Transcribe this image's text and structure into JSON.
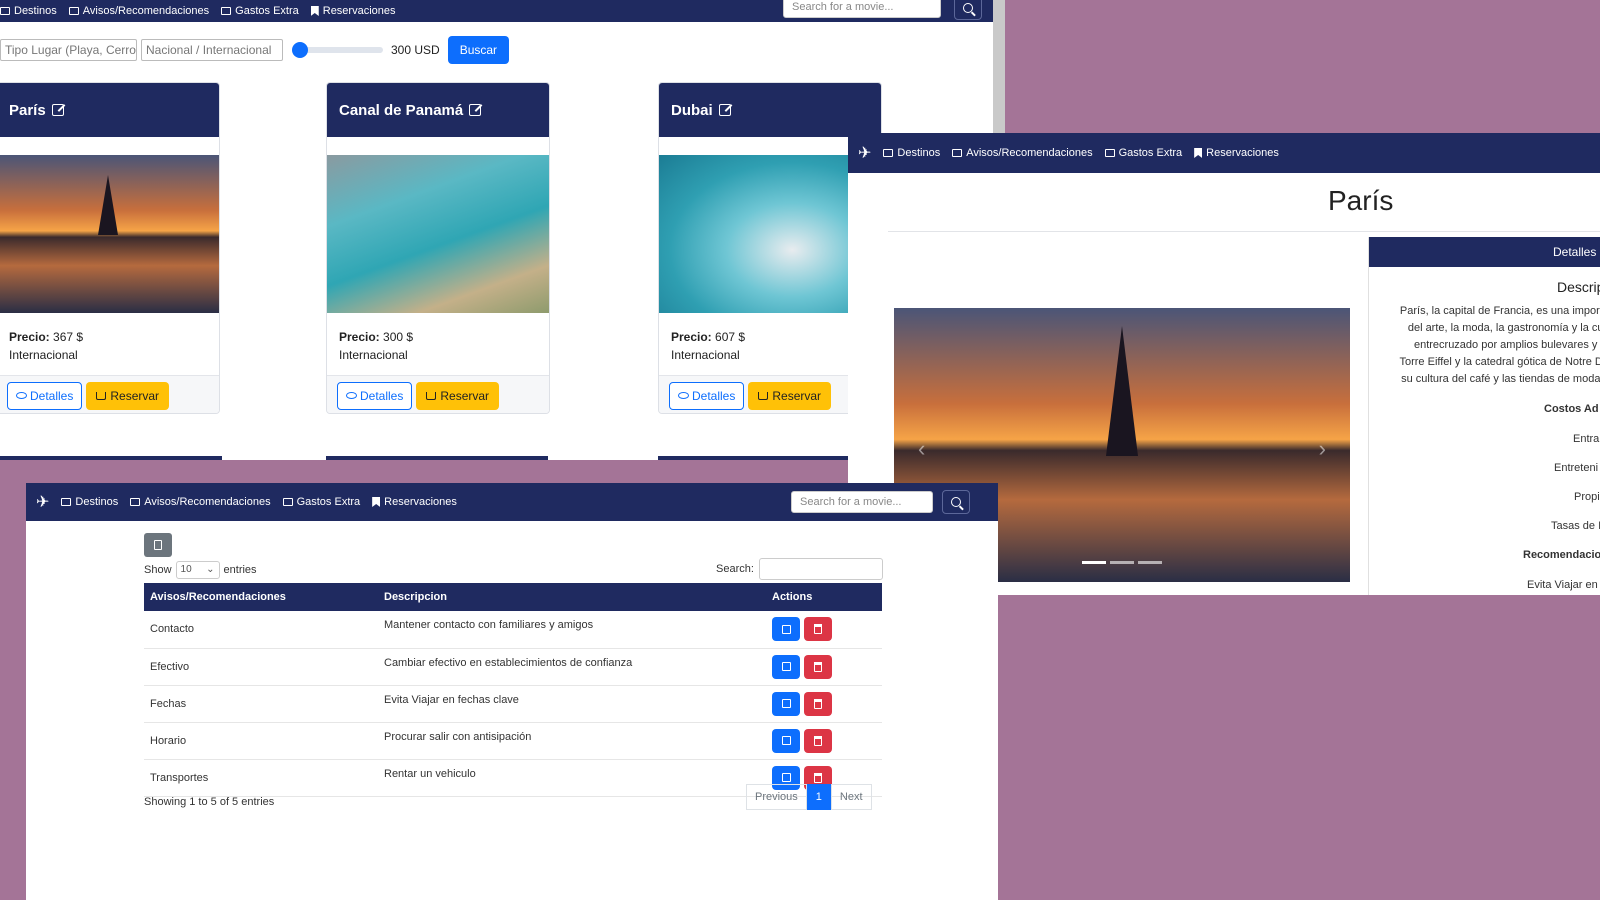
{
  "nav": {
    "items": [
      "Destinos",
      "Avisos/Recomendaciones",
      "Gastos Extra",
      "Reservaciones"
    ],
    "search_placeholder": "Search for a movie..."
  },
  "filters": {
    "tipo_placeholder": "Tipo Lugar (Playa, Cerro, e",
    "nacional_placeholder": "Nacional / Internacional",
    "price_label": "300 USD",
    "price_fraction": 0.08,
    "search_button": "Buscar"
  },
  "cards": [
    {
      "title": "París",
      "precio_label": "Precio:",
      "precio": "367 $",
      "tipo": "Internacional",
      "detalles": "Detalles",
      "reservar": "Reservar"
    },
    {
      "title": "Canal de Panamá",
      "precio_label": "Precio:",
      "precio": "300 $",
      "tipo": "Internacional",
      "detalles": "Detalles",
      "reservar": "Reservar"
    },
    {
      "title": "Dubai",
      "precio_label": "Precio:",
      "precio": "607 $",
      "tipo": "Internacional",
      "detalles": "Detalles",
      "reservar": "Reservar"
    }
  ],
  "detail": {
    "title": "París",
    "panel_header": "Detalles d",
    "description_title": "Descrip",
    "description_lines": [
      "París, la capital de Francia, es una importa",
      "del arte, la moda, la gastronomía y la cult",
      "entrecruzado por amplios bulevares y el",
      "Torre Eiffel y la catedral gótica de Notre Da",
      "su cultura del café y las tiendas de moda c"
    ],
    "costs_title": "Costos Ad",
    "costs": [
      "Entra",
      "Entreteni",
      "Propi",
      "Tasas de In"
    ],
    "recs_title": "Recomendacio",
    "recs_first": "Evita Viajar en"
  },
  "table": {
    "show_label": "Show",
    "entries_value": "10",
    "entries_label": "entries",
    "search_label": "Search:",
    "headers": [
      "Avisos/Recomendaciones",
      "Descripcion",
      "Actions"
    ],
    "rows": [
      {
        "name": "Contacto",
        "desc": "Mantener contacto con familiares y amigos"
      },
      {
        "name": "Efectivo",
        "desc": "Cambiar efectivo en establecimientos de confianza"
      },
      {
        "name": "Fechas",
        "desc": "Evita Viajar en fechas clave"
      },
      {
        "name": "Horario",
        "desc": "Procurar salir con antisipación"
      },
      {
        "name": "Transportes",
        "desc": "Rentar un vehiculo"
      }
    ],
    "info": "Showing 1 to 5 of 5 entries",
    "previous": "Previous",
    "current_page": "1",
    "next": "Next"
  },
  "colors": {
    "navbar": "#1f2a60",
    "primary": "#0d6efd",
    "warning": "#ffc107",
    "danger": "#dc3545",
    "background": "#a47497"
  }
}
